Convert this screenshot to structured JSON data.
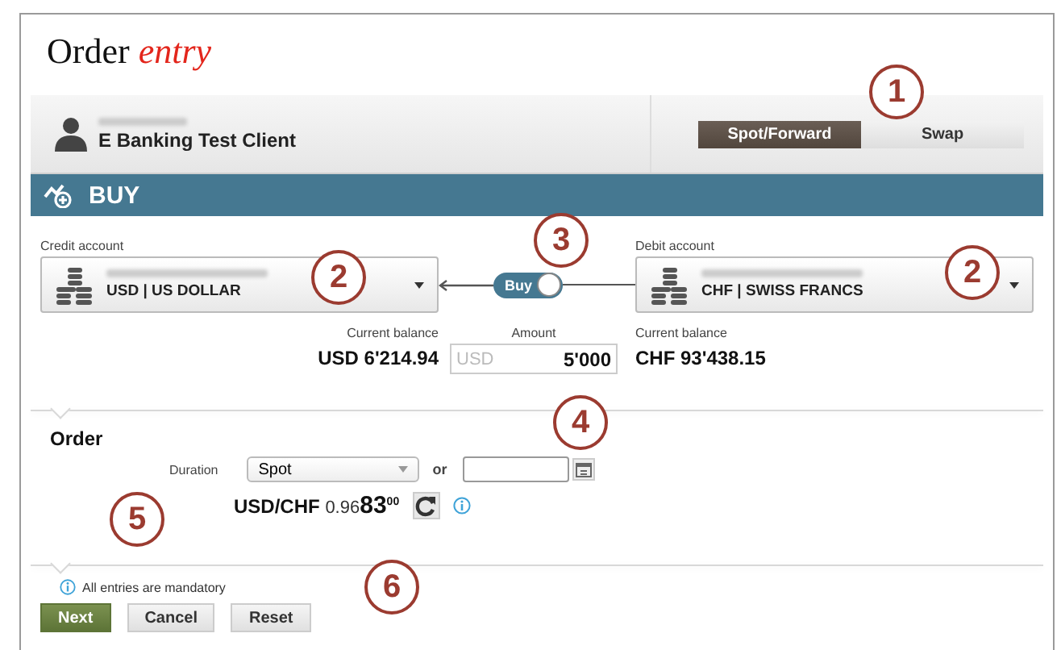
{
  "title": {
    "plain": "Order",
    "accent": "entry"
  },
  "client": {
    "name": "E Banking Test Client"
  },
  "tabs": [
    {
      "label": "Spot/Forward",
      "selected": true
    },
    {
      "label": "Swap",
      "selected": false
    }
  ],
  "action": {
    "label": "BUY"
  },
  "credit_account": {
    "label": "Credit account",
    "currency": "USD | US DOLLAR",
    "balance_label": "Current balance",
    "balance": "USD 6'214.94"
  },
  "direction_toggle": {
    "label": "Buy",
    "on": true
  },
  "amount": {
    "label": "Amount",
    "currency": "USD",
    "value": "5'000"
  },
  "debit_account": {
    "label": "Debit account",
    "currency": "CHF | SWISS FRANCS",
    "balance_label": "Current balance",
    "balance": "CHF 93'438.15"
  },
  "order": {
    "heading": "Order",
    "duration_label": "Duration",
    "duration": "Spot",
    "or": "or",
    "pair": "USD/CHF",
    "rate_prefix": "0.96",
    "rate_big": "83",
    "rate_sup": "00"
  },
  "note": "All entries are mandatory",
  "buttons": [
    {
      "label": "Next",
      "kind": "primary"
    },
    {
      "label": "Cancel",
      "kind": "secondary"
    },
    {
      "label": "Reset",
      "kind": "secondary"
    }
  ],
  "callouts": [
    "1",
    "2",
    "2",
    "3",
    "4",
    "5",
    "6"
  ]
}
